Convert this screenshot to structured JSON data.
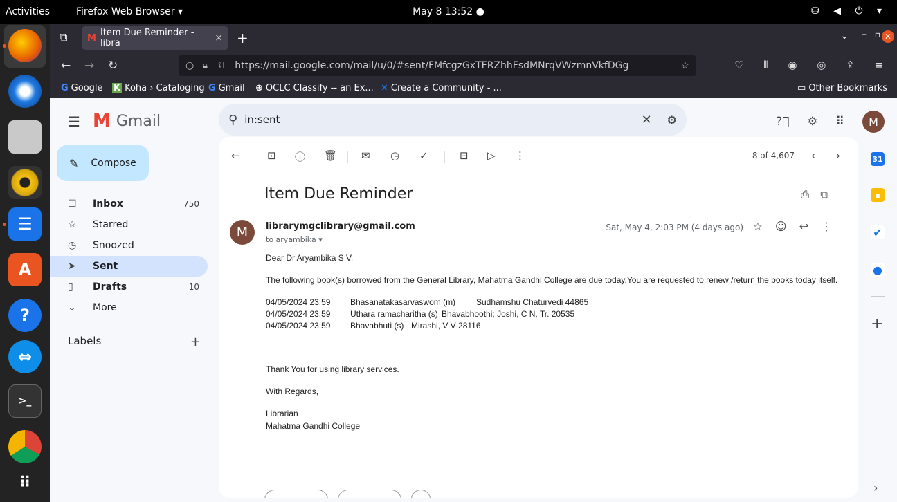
{
  "system": {
    "activities": "Activities",
    "app_menu": "Firefox Web Browser ▾",
    "clock": "May 8  13:52  ●",
    "tray": "⛁ ◀ ⏻ ▾"
  },
  "browser": {
    "tab_title": "Item Due Reminder - libra",
    "tab_close": "×",
    "new_tab": "+",
    "url": "https://mail.google.com/mail/u/0/#sent/FMfcgzGxTFRZhhFsdMNrqVWzmnVkfDGg",
    "bookmarks": [
      {
        "icon": "G",
        "label": "Google"
      },
      {
        "icon": "K",
        "label": "Koha › Cataloging"
      },
      {
        "icon": "G",
        "label": "Gmail"
      },
      {
        "icon": "⊕",
        "label": "OCLC Classify -- an Ex..."
      },
      {
        "icon": "✕",
        "label": "Create a Community - ..."
      }
    ],
    "other_bookmarks": "Other Bookmarks"
  },
  "gmail": {
    "logo_text": "Gmail",
    "search_value": "in:sent",
    "compose_label": "Compose",
    "nav": [
      {
        "icon": "☐",
        "label": "Inbox",
        "count": "750"
      },
      {
        "icon": "☆",
        "label": "Starred",
        "count": ""
      },
      {
        "icon": "◷",
        "label": "Snoozed",
        "count": ""
      },
      {
        "icon": "➤",
        "label": "Sent",
        "count": ""
      },
      {
        "icon": "▯",
        "label": "Drafts",
        "count": "10"
      },
      {
        "icon": "⌄",
        "label": "More",
        "count": ""
      }
    ],
    "labels_heading": "Labels",
    "avatar_letter": "M",
    "pager": "8 of 4,607"
  },
  "message": {
    "subject": "Item Due Reminder",
    "sender": "librarymgclibrary@gmail.com",
    "to": "to aryambika ▾",
    "date": "Sat, May 4, 2:03 PM (4 days ago)",
    "greeting": "Dear Dr Aryambika S V,",
    "intro": "The following book(s) borrowed from the General Library, Mahatma Gandhi College are due today.You are requested to renew /return the books today itself.",
    "books": [
      {
        "due": "04/05/2024 23:59",
        "title": "Bhasanatakasarvaswom (m)",
        "rest": "Sudhamshu Chaturvedi   44865"
      },
      {
        "due": "04/05/2024 23:59",
        "title": "Uthara ramacharitha (s)",
        "rest": "Bhavabhoothi; Joshi, C N, Tr.  20535"
      },
      {
        "due": "04/05/2024 23:59",
        "title": "Bhavabhuti (s)",
        "rest": "Mirashi, V V   28116"
      }
    ],
    "thanks": "Thank You for using library services.",
    "regards": "With Regards,",
    "sign_title": "Librarian",
    "sign_org": "Mahatma Gandhi College"
  }
}
